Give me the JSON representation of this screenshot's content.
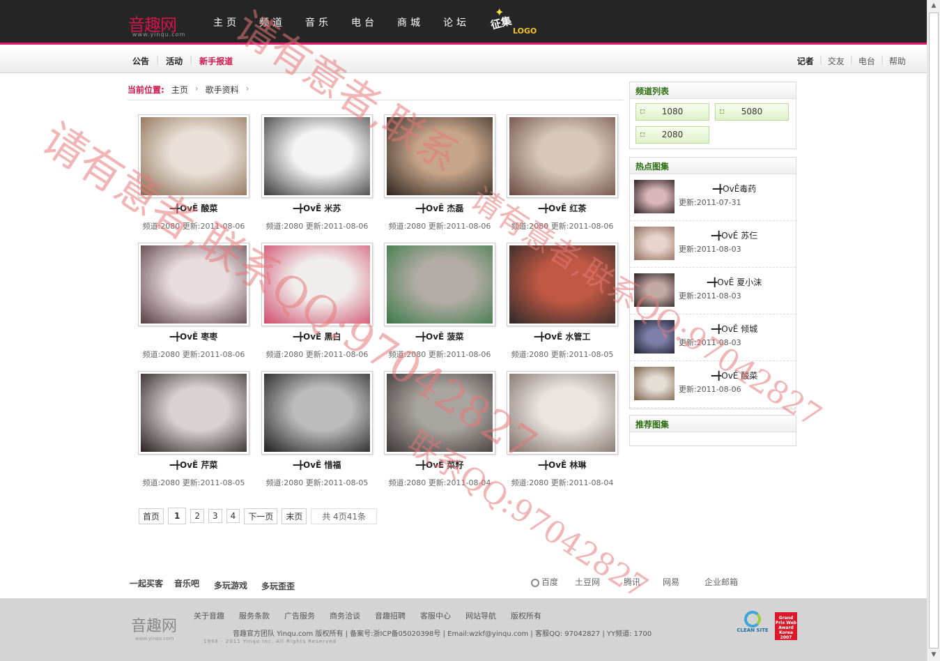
{
  "header": {
    "logo_text": "音趣网",
    "logo_sub": "www.yinqu.com",
    "nav": [
      "主页",
      "频道",
      "音乐",
      "电台",
      "商城",
      "论坛"
    ],
    "badge_main": "征集",
    "badge_sub": "LOGO"
  },
  "subnav": {
    "left": [
      "公告",
      "活动",
      "新手报道"
    ],
    "right": [
      "记者",
      "交友",
      "电台",
      "帮助"
    ]
  },
  "breadcrumb": {
    "label": "当前位置:",
    "items": [
      "主页",
      "歌手资料"
    ]
  },
  "singers": [
    {
      "name": "━╋OvĚ 酸菜",
      "channel": "2080",
      "date": "2011-08-06",
      "c1": "#e9e1d7",
      "c2": "#8a6a50"
    },
    {
      "name": "━╋OvĚ 米苏",
      "channel": "2080",
      "date": "2011-08-06",
      "c1": "#f4f4f4",
      "c2": "#3a3a3a"
    },
    {
      "name": "━╋OvĚ 杰磊",
      "channel": "2080",
      "date": "2011-08-06",
      "c1": "#c7a58a",
      "c2": "#2c2520"
    },
    {
      "name": "━╋OvĚ 红茶",
      "channel": "2080",
      "date": "2011-08-06",
      "c1": "#d8c8bc",
      "c2": "#6b4a3e"
    },
    {
      "name": "━╋OvĚ 枣枣",
      "channel": "2080",
      "date": "2011-08-06",
      "c1": "#e8dcdf",
      "c2": "#5a3e44"
    },
    {
      "name": "━╋OvĚ 黑白",
      "channel": "2080",
      "date": "2011-08-06",
      "c1": "#f0eeec",
      "c2": "#d04a6c"
    },
    {
      "name": "━╋OvĚ 菠菜",
      "channel": "2080",
      "date": "2011-08-06",
      "c1": "#b3aca6",
      "c2": "#3b7a46"
    },
    {
      "name": "━╋OvĚ 水管工",
      "channel": "2080",
      "date": "2011-08-05",
      "c1": "#c05844",
      "c2": "#2a2a2a"
    },
    {
      "name": "━╋OvĚ 芹菜",
      "channel": "2080",
      "date": "2011-08-05",
      "c1": "#d8d2d0",
      "c2": "#2a2022"
    },
    {
      "name": "━╋OvĚ 惜福",
      "channel": "2080",
      "date": "2011-08-05",
      "c1": "#bcbcbc",
      "c2": "#1e1e1e"
    },
    {
      "name": "━╋OvĚ 菜籽",
      "channel": "2080",
      "date": "2011-08-04",
      "c1": "#a8a4a0",
      "c2": "#3e3836"
    },
    {
      "name": "━╋OvĚ 林琳",
      "channel": "2080",
      "date": "2011-08-04",
      "c1": "#e9e4e0",
      "c2": "#7e6e66"
    }
  ],
  "labels": {
    "channel_prefix": "频道:",
    "date_prefix": "更新:"
  },
  "pager": {
    "first": "首页",
    "pages": [
      "1",
      "2",
      "3",
      "4"
    ],
    "current": "1",
    "next": "下一页",
    "last": "末页",
    "total": "共 4页41条"
  },
  "channels": {
    "title": "频道列表",
    "items": [
      "1080",
      "5080",
      "2080"
    ]
  },
  "hot": {
    "title": "热点图集",
    "items": [
      {
        "name": "━╋OvĚ毒药",
        "date": "更新:2011-07-31",
        "c1": "#d9b6b9",
        "c2": "#2b1e22"
      },
      {
        "name": "━╋OvĚ 苏仨",
        "date": "更新:2011-08-03",
        "c1": "#e8d4cc",
        "c2": "#8e6b5c"
      },
      {
        "name": "━╋OvĚ 夏小沫",
        "date": "更新:2011-08-03",
        "c1": "#c4a8a4",
        "c2": "#2c2424"
      },
      {
        "name": "━╋OvĚ 倾城",
        "date": "更新:2011-08-03",
        "c1": "#7d7fa8",
        "c2": "#1e1e2c"
      },
      {
        "name": "━╋OvĚ 酸菜",
        "date": "更新:2011-08-06",
        "c1": "#e4ddd4",
        "c2": "#7a6048"
      }
    ]
  },
  "recommend": {
    "title": "推荐图集"
  },
  "footer_links": {
    "left": [
      "一起买客",
      "音乐吧",
      "多玩游戏",
      "多玩歪歪"
    ],
    "right": [
      "百度",
      "土豆网",
      "腾讯",
      "网易",
      "企业邮箱"
    ]
  },
  "footer": {
    "logo_text": "音趣网",
    "logo_sub": "www.yinqu.com",
    "nav": [
      "关于音趣",
      "服务条款",
      "广告服务",
      "商务洽谈",
      "音趣招聘",
      "客服中心",
      "网站导航",
      "版权所有"
    ],
    "info": "音趣官方团队  Yinqu.com 版权所有 | 备案号:浙ICP备05020398号 | Email:wzkf@yinqu.com | 客服QQ: 97042827 | YY频道: 1700",
    "copy": "1998 - 2011 Yinqu Inc. All Rights Reserved",
    "badge1": "CLEAN SITE",
    "badge2": "Grand Prix Web Award Korea 2007"
  },
  "watermarks": {
    "big1": "请有意者,联系",
    "big2": "请有意者,联系QQ:97042827",
    "mid1": "请有意者,联系QQ:97042827",
    "mid2": "联系QQ:97042827"
  }
}
